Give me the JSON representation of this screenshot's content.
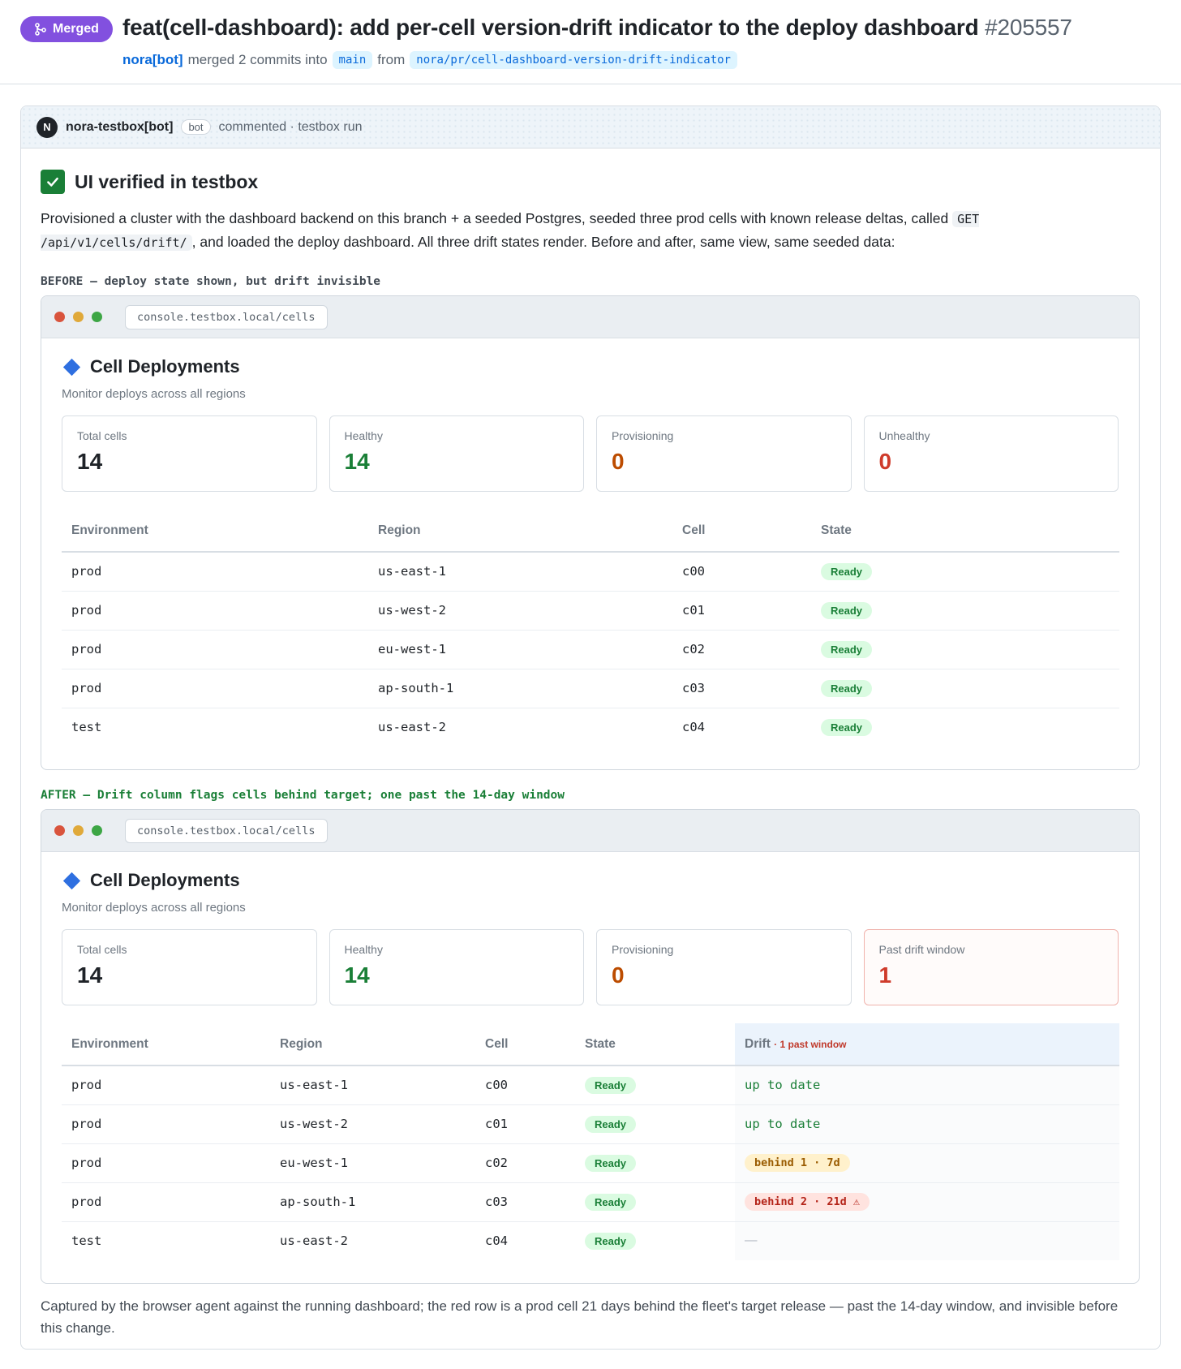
{
  "pr": {
    "badge": "Merged",
    "title": "feat(cell-dashboard): add per-cell version-drift indicator to the deploy dashboard",
    "number": "#205557",
    "author": "nora[bot]",
    "merged_text": "merged 2 commits into",
    "base_branch": "main",
    "from_text": "from",
    "head_branch": "nora/pr/cell-dashboard-version-drift-indicator"
  },
  "comment": {
    "avatar_letter": "N",
    "commenter": "nora-testbox[bot]",
    "bot_tag": "bot",
    "meta": "commented · testbox run",
    "verified_title": "UI verified in testbox",
    "desc_part1": "Provisioned a cluster with the dashboard backend on this branch + a seeded Postgres, seeded three prod cells with known release deltas, called ",
    "desc_code": "GET /api/v1/cells/drift/",
    "desc_part2": ", and loaded the deploy dashboard. All three drift states render. Before and after, same view, same seeded data:",
    "before_caption": "BEFORE — deploy state shown, but drift invisible",
    "after_caption": "AFTER — Drift column flags cells behind target; one past the 14-day window",
    "footer": "Captured by the browser agent against the running dashboard; the red row is a prod cell 21 days behind the fleet's target release — past the 14-day window, and invisible before this change."
  },
  "before": {
    "url": "console.testbox.local/cells",
    "title": "Cell Deployments",
    "subtitle": "Monitor deploys across all regions",
    "stats": [
      {
        "label": "Total cells",
        "value": "14"
      },
      {
        "label": "Healthy",
        "value": "14"
      },
      {
        "label": "Provisioning",
        "value": "0"
      },
      {
        "label": "Unhealthy",
        "value": "0"
      }
    ],
    "columns": [
      "Environment",
      "Region",
      "Cell",
      "State"
    ],
    "rows": [
      {
        "env": "prod",
        "region": "us-east-1",
        "cell": "c00",
        "state": "Ready"
      },
      {
        "env": "prod",
        "region": "us-west-2",
        "cell": "c01",
        "state": "Ready"
      },
      {
        "env": "prod",
        "region": "eu-west-1",
        "cell": "c02",
        "state": "Ready"
      },
      {
        "env": "prod",
        "region": "ap-south-1",
        "cell": "c03",
        "state": "Ready"
      },
      {
        "env": "test",
        "region": "us-east-2",
        "cell": "c04",
        "state": "Ready"
      }
    ]
  },
  "after": {
    "url": "console.testbox.local/cells",
    "title": "Cell Deployments",
    "subtitle": "Monitor deploys across all regions",
    "stats": [
      {
        "label": "Total cells",
        "value": "14"
      },
      {
        "label": "Healthy",
        "value": "14"
      },
      {
        "label": "Provisioning",
        "value": "0"
      },
      {
        "label": "Past drift window",
        "value": "1"
      }
    ],
    "columns": [
      "Environment",
      "Region",
      "Cell",
      "State",
      "Drift"
    ],
    "drift_note": "· 1 past window",
    "rows": [
      {
        "env": "prod",
        "region": "us-east-1",
        "cell": "c00",
        "state": "Ready",
        "drift": "up to date"
      },
      {
        "env": "prod",
        "region": "us-west-2",
        "cell": "c01",
        "state": "Ready",
        "drift": "up to date"
      },
      {
        "env": "prod",
        "region": "eu-west-1",
        "cell": "c02",
        "state": "Ready",
        "drift": "behind 1 · 7d"
      },
      {
        "env": "prod",
        "region": "ap-south-1",
        "cell": "c03",
        "state": "Ready",
        "drift": "behind 2 · 21d ⚠"
      },
      {
        "env": "test",
        "region": "us-east-2",
        "cell": "c04",
        "state": "Ready",
        "drift": "—"
      }
    ]
  },
  "colors": {
    "merged": "#8250df",
    "success": "#1a7f37",
    "link": "#0969da",
    "warning": "#9a5b00",
    "danger": "#b42318"
  }
}
